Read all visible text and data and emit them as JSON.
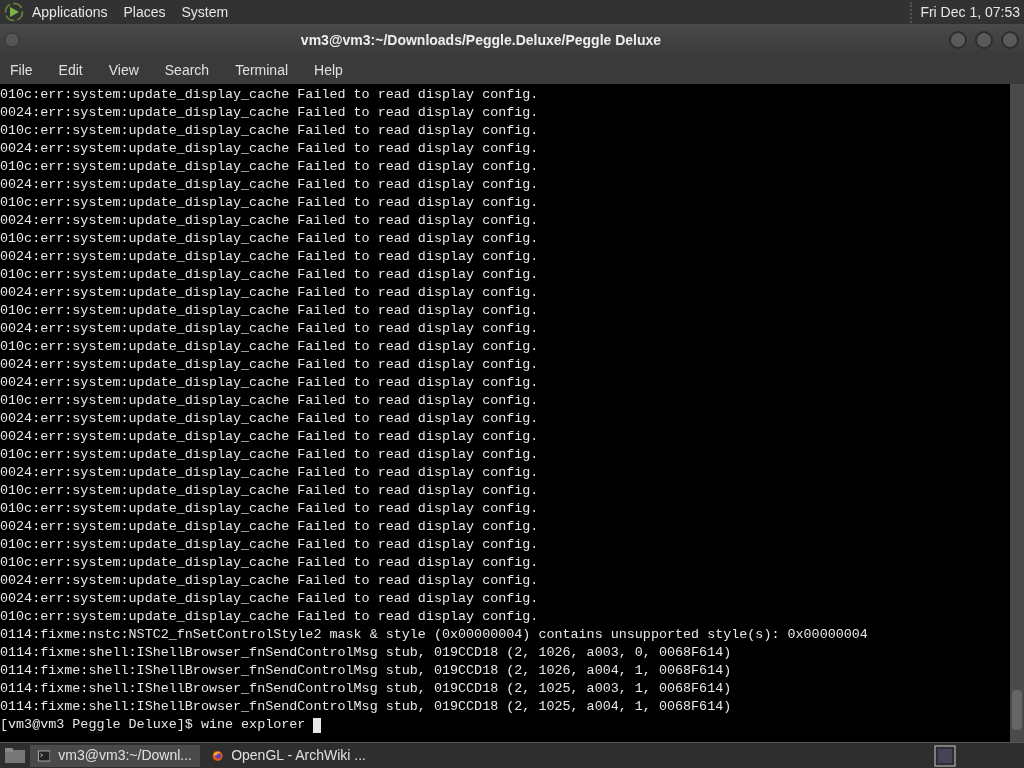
{
  "top_panel": {
    "menus": [
      "Applications",
      "Places",
      "System"
    ],
    "clock": "Fri Dec 1, 07:53"
  },
  "window": {
    "title": "vm3@vm3:~/Downloads/Peggle.Deluxe/Peggle Deluxe"
  },
  "menu_bar": [
    "File",
    "Edit",
    "View",
    "Search",
    "Terminal",
    "Help"
  ],
  "terminal": {
    "lines": [
      "010c:err:system:update_display_cache Failed to read display config.",
      "0024:err:system:update_display_cache Failed to read display config.",
      "010c:err:system:update_display_cache Failed to read display config.",
      "0024:err:system:update_display_cache Failed to read display config.",
      "010c:err:system:update_display_cache Failed to read display config.",
      "0024:err:system:update_display_cache Failed to read display config.",
      "010c:err:system:update_display_cache Failed to read display config.",
      "0024:err:system:update_display_cache Failed to read display config.",
      "010c:err:system:update_display_cache Failed to read display config.",
      "0024:err:system:update_display_cache Failed to read display config.",
      "010c:err:system:update_display_cache Failed to read display config.",
      "0024:err:system:update_display_cache Failed to read display config.",
      "010c:err:system:update_display_cache Failed to read display config.",
      "0024:err:system:update_display_cache Failed to read display config.",
      "010c:err:system:update_display_cache Failed to read display config.",
      "0024:err:system:update_display_cache Failed to read display config.",
      "0024:err:system:update_display_cache Failed to read display config.",
      "010c:err:system:update_display_cache Failed to read display config.",
      "0024:err:system:update_display_cache Failed to read display config.",
      "0024:err:system:update_display_cache Failed to read display config.",
      "010c:err:system:update_display_cache Failed to read display config.",
      "0024:err:system:update_display_cache Failed to read display config.",
      "010c:err:system:update_display_cache Failed to read display config.",
      "010c:err:system:update_display_cache Failed to read display config.",
      "0024:err:system:update_display_cache Failed to read display config.",
      "010c:err:system:update_display_cache Failed to read display config.",
      "010c:err:system:update_display_cache Failed to read display config.",
      "0024:err:system:update_display_cache Failed to read display config.",
      "0024:err:system:update_display_cache Failed to read display config.",
      "010c:err:system:update_display_cache Failed to read display config.",
      "0114:fixme:nstc:NSTC2_fnSetControlStyle2 mask & style (0x00000004) contains unsupported style(s): 0x00000004",
      "0114:fixme:shell:IShellBrowser_fnSendControlMsg stub, 019CCD18 (2, 1026, a003, 0, 0068F614)",
      "0114:fixme:shell:IShellBrowser_fnSendControlMsg stub, 019CCD18 (2, 1026, a004, 1, 0068F614)",
      "0114:fixme:shell:IShellBrowser_fnSendControlMsg stub, 019CCD18 (2, 1025, a003, 1, 0068F614)",
      "0114:fixme:shell:IShellBrowser_fnSendControlMsg stub, 019CCD18 (2, 1025, a004, 1, 0068F614)"
    ],
    "prompt": "[vm3@vm3 Peggle Deluxe]$ wine explorer"
  },
  "taskbar": {
    "tasks": [
      {
        "kind": "terminal",
        "label": "vm3@vm3:~/Downl...",
        "selected": true
      },
      {
        "kind": "browser",
        "label": "OpenGL - ArchWiki ...",
        "selected": false
      }
    ]
  }
}
